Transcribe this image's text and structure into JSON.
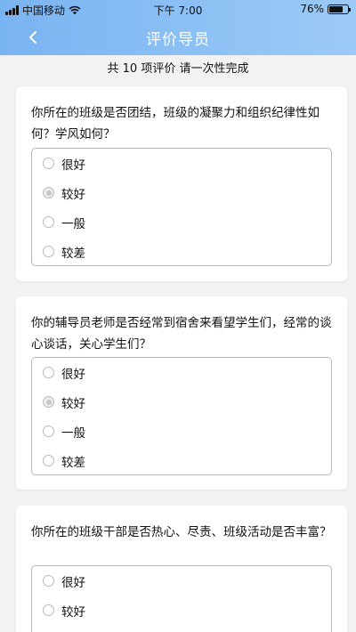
{
  "status": {
    "carrier": "中国移动",
    "time": "下午 7:00",
    "battery": "76%",
    "battery_level": 0.76
  },
  "header": {
    "title": "评价导员"
  },
  "subtitle": "共 10 项评价  请一次性完成",
  "questions": [
    {
      "text": "你所在的班级是否团结，班级的凝聚力和组织纪律性如何？学风如何？",
      "options": [
        "很好",
        "较好",
        "一般",
        "较差"
      ],
      "selected": 1
    },
    {
      "text": "你的辅导员老师是否经常到宿舍来看望学生们，经常的谈心谈话，关心学生们？",
      "options": [
        "很好",
        "较好",
        "一般",
        "较差"
      ],
      "selected": 1
    },
    {
      "text": "你所在的班级干部是否热心、尽责、班级活动是否丰富？",
      "options": [
        "很好",
        "较好"
      ],
      "selected": null
    }
  ]
}
